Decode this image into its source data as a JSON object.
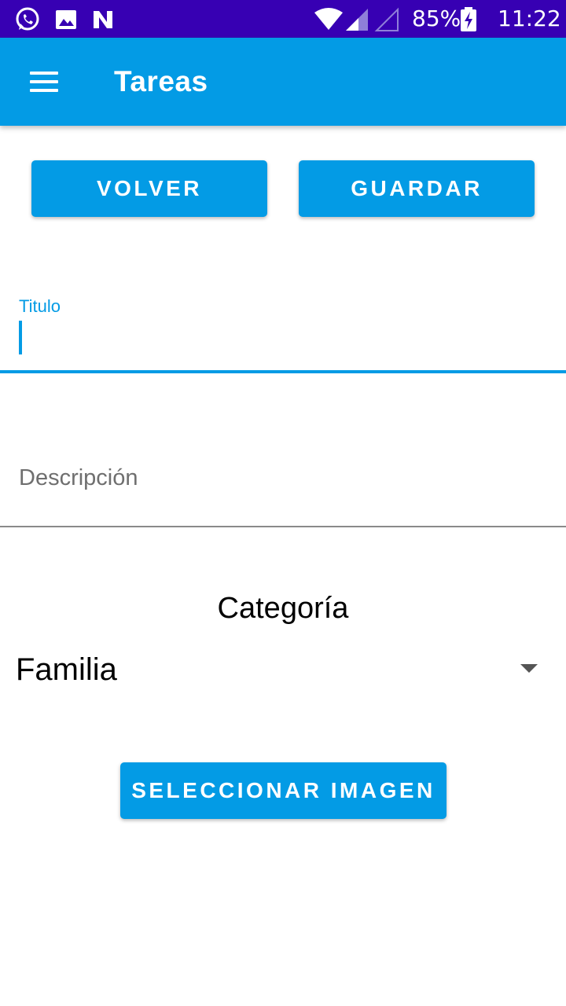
{
  "status_bar": {
    "icons": [
      "whatsapp-icon",
      "gallery-icon",
      "n-notification-icon",
      "wifi-icon",
      "signal-icon",
      "signal-empty-icon",
      "battery-charging-icon"
    ],
    "battery": "85%",
    "time": "11:22"
  },
  "app_bar": {
    "title": "Tareas",
    "menu_icon": "hamburger-menu-icon"
  },
  "buttons": {
    "back": "VOLVER",
    "save": "GUARDAR",
    "select_image": "SELECCIONAR IMAGEN"
  },
  "form": {
    "title_label": "Titulo",
    "title_value": "",
    "description_placeholder": "Descripción",
    "category_label": "Categoría",
    "category_value": "Familia"
  },
  "colors": {
    "status_bar": "#3700b3",
    "primary": "#039be5"
  }
}
